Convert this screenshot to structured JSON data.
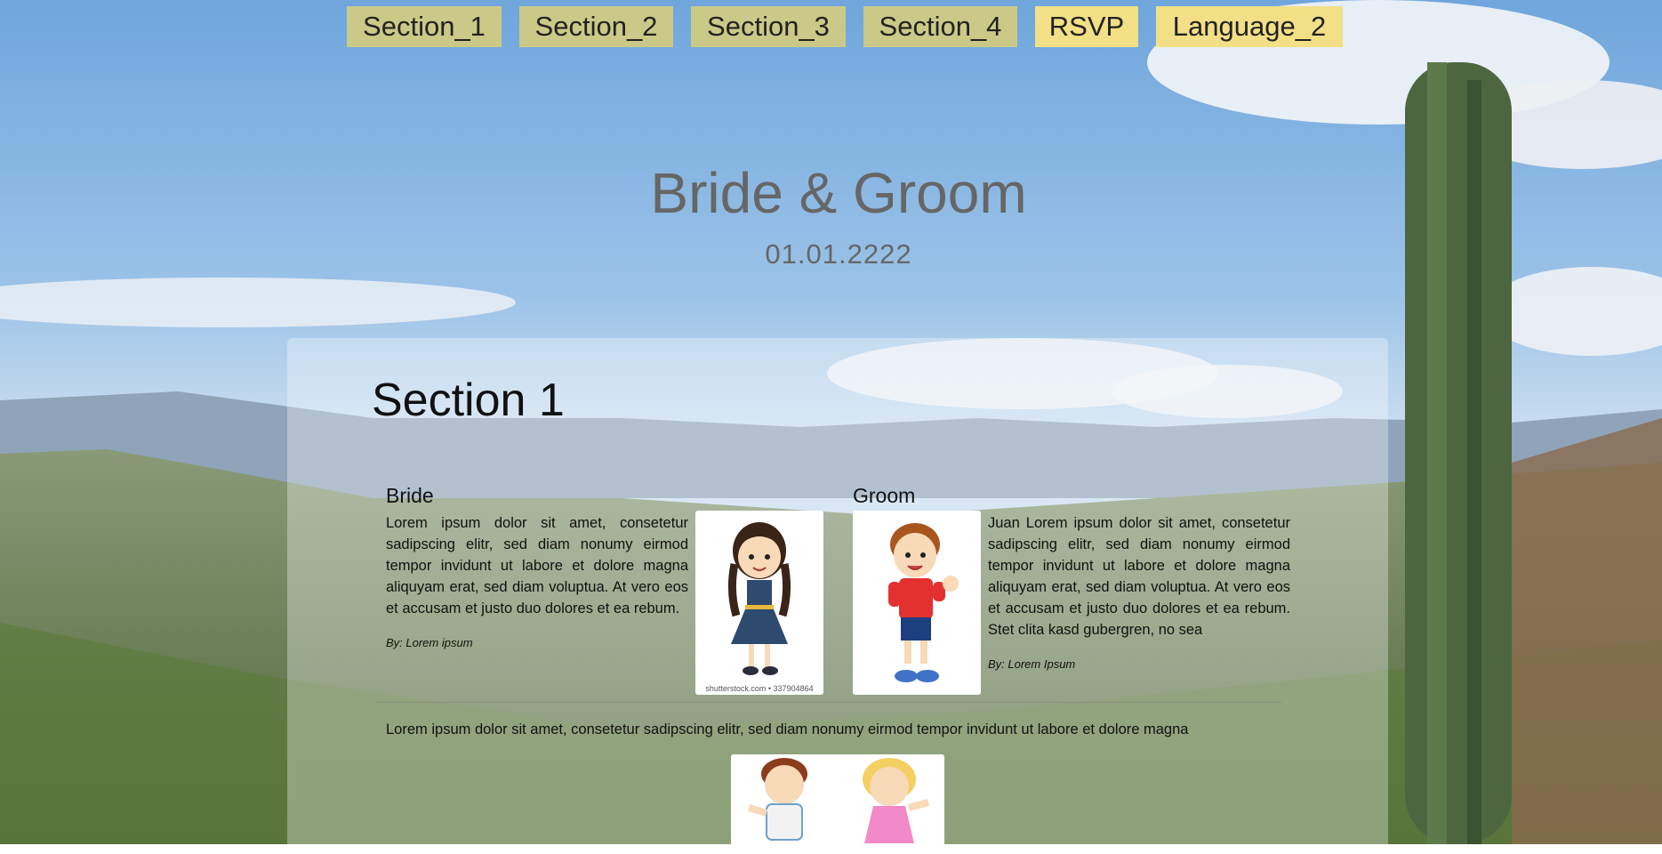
{
  "nav": {
    "items": [
      {
        "label": "Section_1"
      },
      {
        "label": "Section_2"
      },
      {
        "label": "Section_3"
      },
      {
        "label": "Section_4"
      },
      {
        "label": "RSVP"
      },
      {
        "label": "Language_2"
      }
    ]
  },
  "hero": {
    "title": "Bride & Groom",
    "date": "01.01.2222"
  },
  "section1": {
    "title": "Section 1",
    "bride": {
      "heading": "Bride",
      "text": "Lorem ipsum dolor sit amet, consetetur sadipscing elitr, sed diam nonumy eirmod tempor invidunt ut labore et dolore magna aliquyam erat, sed diam voluptua. At vero eos et accusam et justo duo dolores et ea rebum.",
      "byline": "By: Lorem ipsum",
      "photo_caption": "shutterstock.com • 337904864"
    },
    "groom": {
      "heading": "Groom",
      "text": "Juan Lorem ipsum dolor sit amet, consetetur sadipscing elitr, sed diam nonumy eirmod tempor invidunt ut labore et dolore magna aliquyam erat, sed diam voluptua. At vero eos et accusam et justo duo dolores et ea rebum. Stet clita kasd gubergren, no sea",
      "byline": "By: Lorem Ipsum"
    },
    "bottom_text": "Lorem ipsum dolor sit amet, consetetur sadipscing elitr, sed diam nonumy eirmod tempor invidunt ut labore et dolore magna"
  },
  "colors": {
    "nav_section_bg": "#cbc987",
    "nav_accent_bg": "#f3df86",
    "hero_text": "#666666"
  }
}
